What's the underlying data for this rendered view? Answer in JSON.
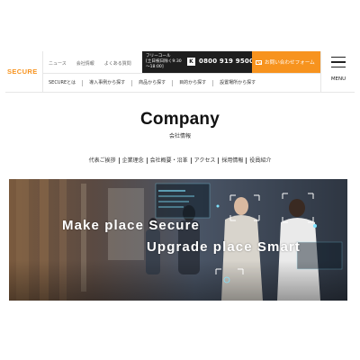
{
  "header": {
    "logo": "SECURE",
    "toplinks": [
      "ニュース",
      "会社情報",
      "よくある質問"
    ],
    "phone": {
      "label_line1": "フリーコール",
      "label_line2": "[土日祝日除く9:30",
      "label_line3": "〜18:00]",
      "badge": "K",
      "number": "0800 919 9500"
    },
    "contact_label": "お問い合わせフォーム",
    "menu_label": "MENU",
    "nav": [
      "SECUREとは",
      "導入事例から探す",
      "商品から探す",
      "目的から探す",
      "設置場所から探す"
    ]
  },
  "main": {
    "title": "Company",
    "subtitle": "会社情報",
    "subnav": [
      "代表ご挨拶",
      "企業理念",
      "会社概要・沿革",
      "アクセス",
      "採用情報",
      "役員紹介"
    ]
  },
  "hero": {
    "line1": "Make place Secure",
    "line2": "Upgrade place Smart"
  },
  "colors": {
    "brand": "#f7931e",
    "dark": "#1e1e1e",
    "hud_accent": "#7fe3ff"
  }
}
